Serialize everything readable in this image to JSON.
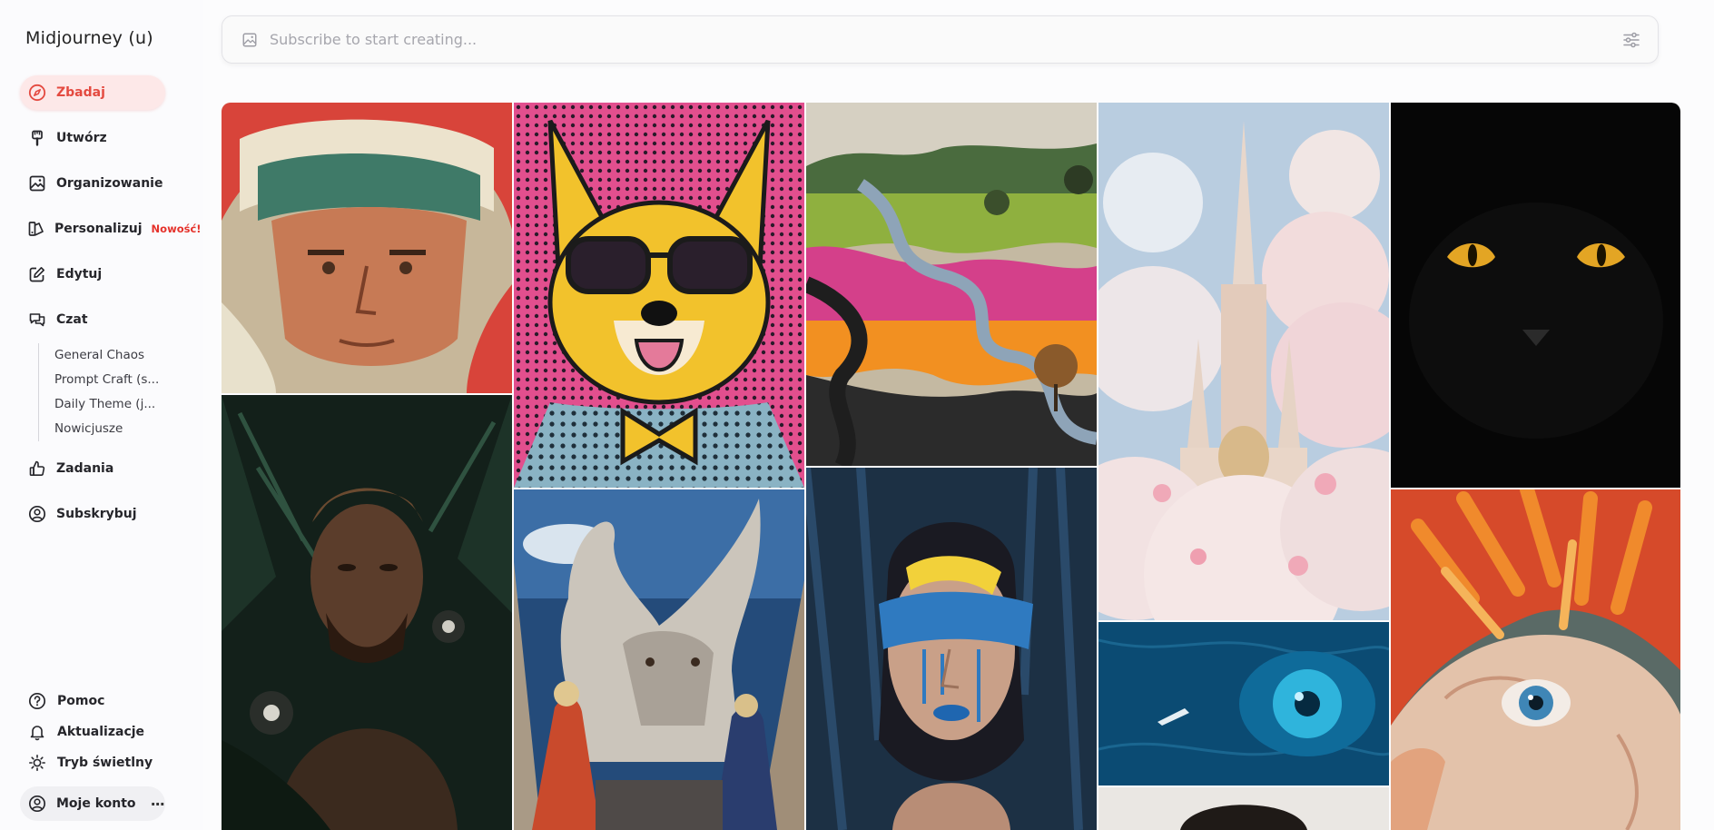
{
  "app": {
    "title": "Midjourney (u)"
  },
  "nav": {
    "items": [
      {
        "label": "Zbadaj",
        "icon": "compass-icon",
        "active": true
      },
      {
        "label": "Utwórz",
        "icon": "brush-icon"
      },
      {
        "label": "Organizowanie",
        "icon": "image-icon"
      },
      {
        "label": "Personalizuj",
        "icon": "palette-icon",
        "badge": "Nowość!"
      },
      {
        "label": "Edytuj",
        "icon": "edit-icon"
      },
      {
        "label": "Czat",
        "icon": "chat-icon"
      }
    ],
    "chat_rooms": [
      "General Chaos",
      "Prompt Craft (s...",
      "Daily Theme (j...",
      "Nowicjusze"
    ],
    "tasks_label": "Zadania",
    "subscribe_label": "Subskrybuj"
  },
  "bottom": {
    "help": "Pomoc",
    "updates": "Aktualizacje",
    "theme": "Tryb świetlny",
    "account": "Moje konto"
  },
  "search": {
    "placeholder": "Subscribe to start creating..."
  },
  "colors": {
    "accent": "#e44a40",
    "active_bg": "#fde8e8"
  }
}
